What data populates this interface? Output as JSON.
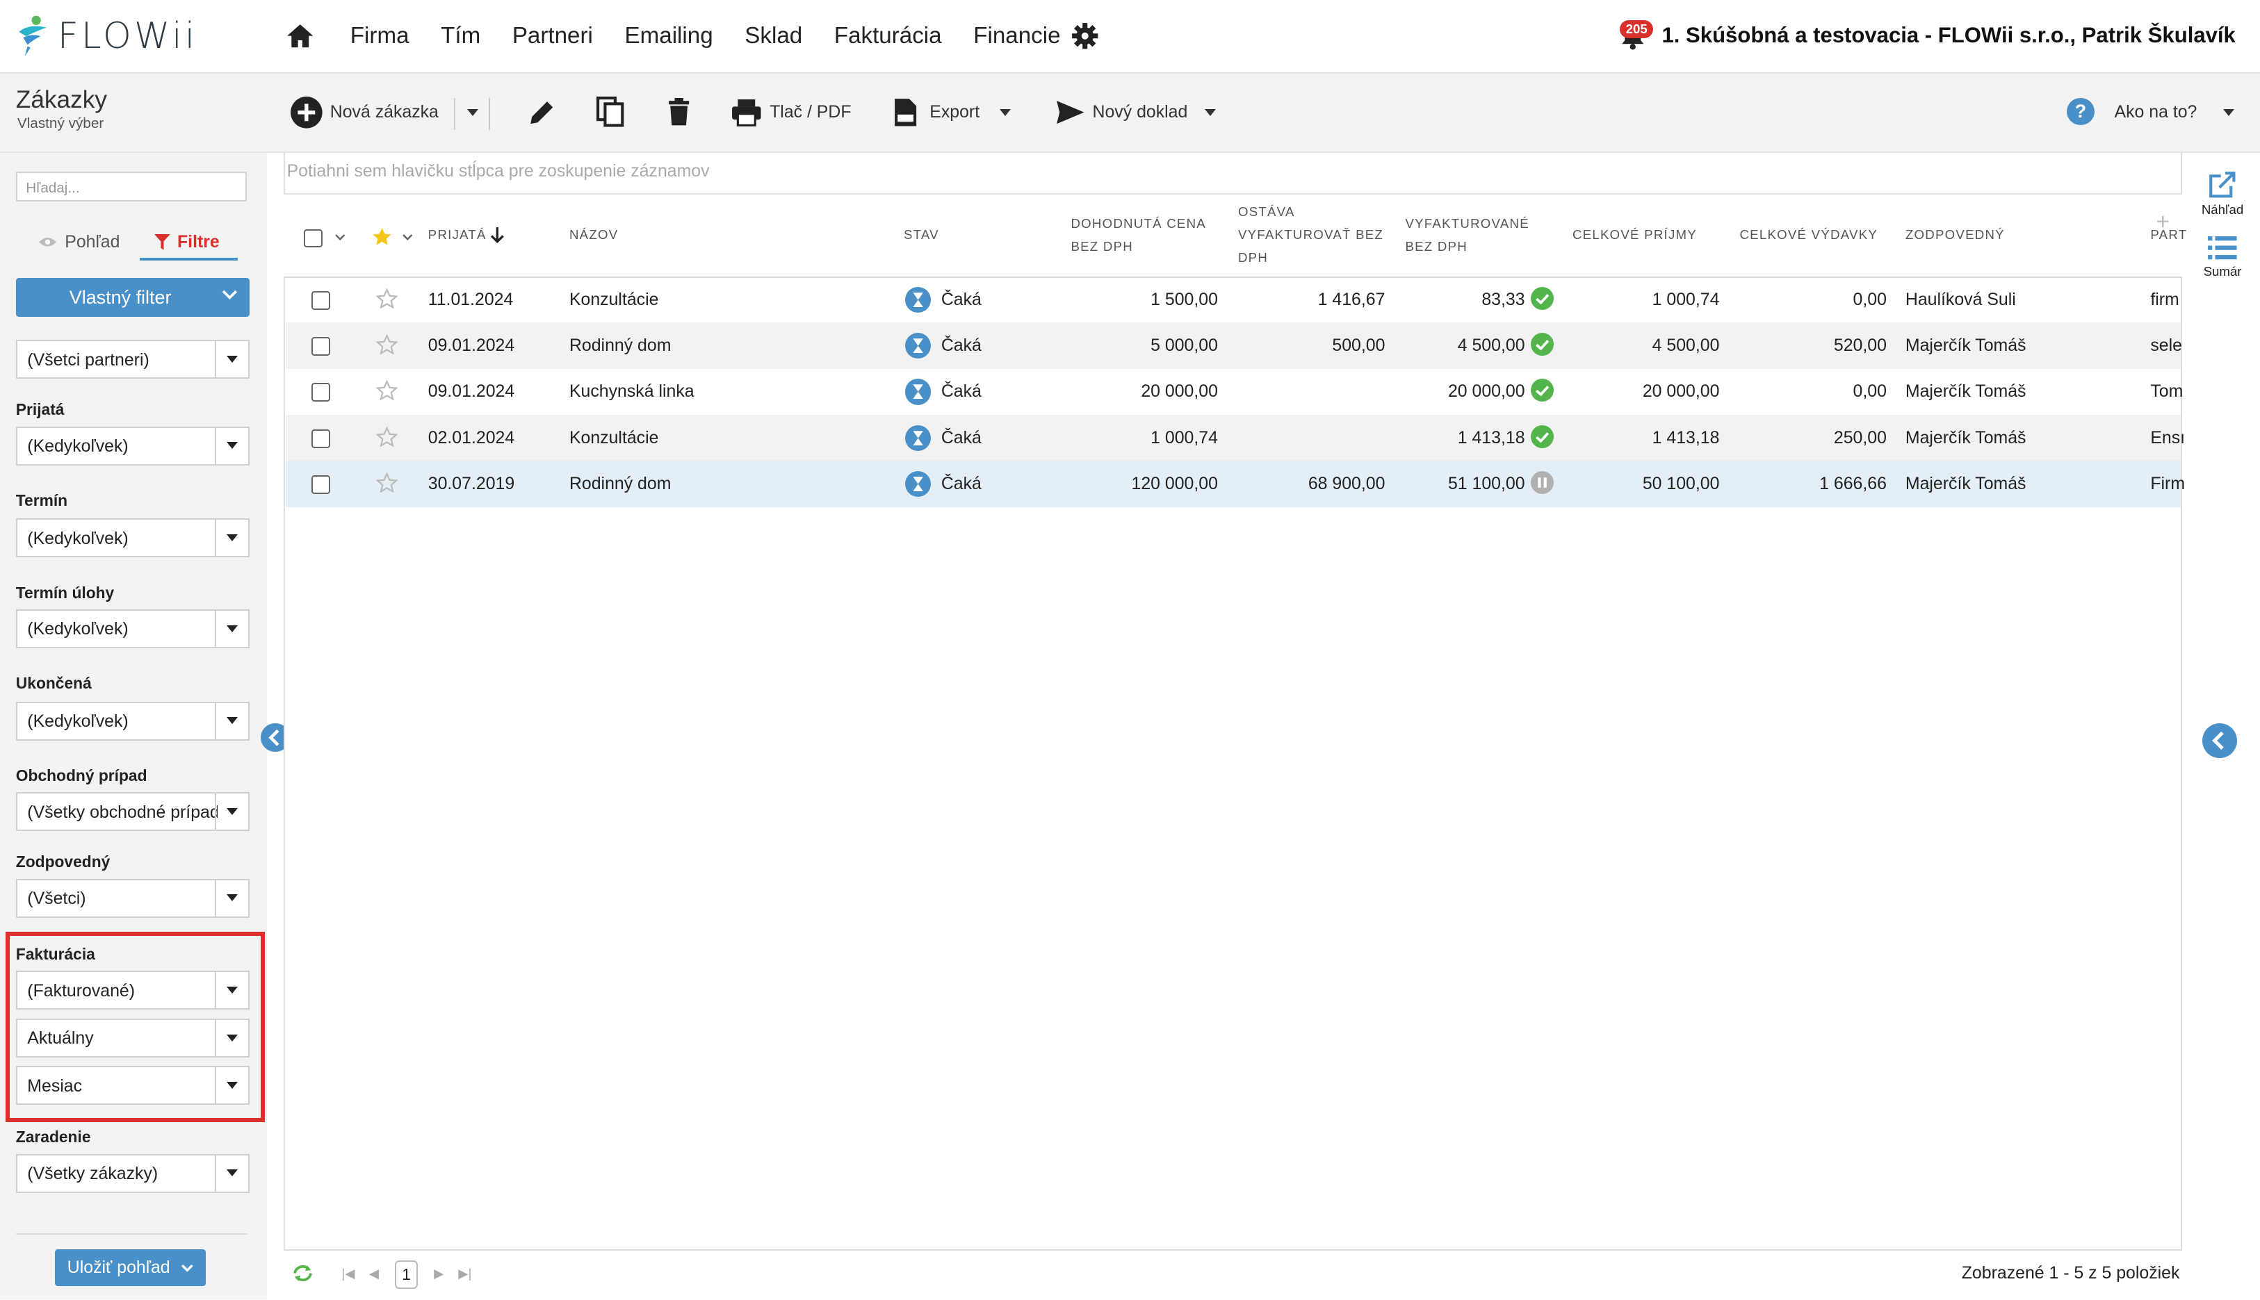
{
  "app": {
    "logo_text": "FLOWii",
    "brand_color": "#4a90c8",
    "accent_red": "#d9302c"
  },
  "nav": {
    "items": [
      "Firma",
      "Tím",
      "Partneri",
      "Emailing",
      "Sklad",
      "Fakturácia",
      "Financie"
    ],
    "notification_count": "205",
    "company_user": "1. Skúšobná a testovacia - FLOWii s.r.o., Patrik Škulavík"
  },
  "page": {
    "title": "Zákazky",
    "subtitle": "Vlastný výber"
  },
  "toolbar": {
    "new_order": "Nová zákazka",
    "print": "Tlač / PDF",
    "export": "Export",
    "new_document": "Nový doklad",
    "help": "Ako na to?"
  },
  "sidebar": {
    "search_placeholder": "Hľadaj...",
    "tab_view": "Pohľad",
    "tab_filters": "Filtre",
    "custom_filter": "Vlastný filter",
    "partners": "(Všetci partneri)",
    "filters": [
      {
        "label": "Prijatá",
        "value": "(Kedykoľvek)"
      },
      {
        "label": "Termín",
        "value": "(Kedykoľvek)"
      },
      {
        "label": "Termín úlohy",
        "value": "(Kedykoľvek)"
      },
      {
        "label": "Ukončená",
        "value": "(Kedykoľvek)"
      },
      {
        "label": "Obchodný prípad",
        "value": "(Všetky obchodné prípady)"
      },
      {
        "label": "Zodpovedný",
        "value": "(Všetci)"
      }
    ],
    "invoicing": {
      "label": "Fakturácia",
      "values": [
        "(Fakturované)",
        "Aktuálny",
        "Mesiac"
      ]
    },
    "assignment": {
      "label": "Zaradenie",
      "value": "(Všetky zákazky)"
    },
    "save_view": "Uložiť pohľad"
  },
  "grid": {
    "group_hint": "Potiahni sem hlavičku stĺpca pre zoskupenie záznamov",
    "columns": {
      "received": "Prijatá",
      "name": "Názov",
      "status": "Stav",
      "agreed_1": "Dohodnutá cena",
      "agreed_2": "bez DPH",
      "remain_1": "Ostáva",
      "remain_2": "vyfakturovať bez",
      "remain_3": "DPH",
      "invoiced_1": "Vyfakturované",
      "invoiced_2": "bez DPH",
      "income": "Celkové príjmy",
      "expenses": "Celkové výdavky",
      "responsible": "Zodpovedný",
      "partner": "Part"
    },
    "rows": [
      {
        "date": "11.01.2024",
        "name": "Konzultácie",
        "status": "Čaká",
        "agreed": "1 500,00",
        "remaining": "1 416,67",
        "invoiced": "83,33",
        "invoiced_state": "ok",
        "income": "1 000,74",
        "expenses": "0,00",
        "responsible": "Haulíková Suli",
        "partner": "firm"
      },
      {
        "date": "09.01.2024",
        "name": "Rodinný dom",
        "status": "Čaká",
        "agreed": "5 000,00",
        "remaining": "500,00",
        "invoiced": "4 500,00",
        "invoiced_state": "ok",
        "income": "4 500,00",
        "expenses": "520,00",
        "responsible": "Majerčík Tomáš",
        "partner": "sele"
      },
      {
        "date": "09.01.2024",
        "name": "Kuchynská linka",
        "status": "Čaká",
        "agreed": "20 000,00",
        "remaining": "",
        "invoiced": "20 000,00",
        "invoiced_state": "ok",
        "income": "20 000,00",
        "expenses": "0,00",
        "responsible": "Majerčík Tomáš",
        "partner": "Tom"
      },
      {
        "date": "02.01.2024",
        "name": "Konzultácie",
        "status": "Čaká",
        "agreed": "1 000,74",
        "remaining": "",
        "invoiced": "1 413,18",
        "invoiced_state": "ok",
        "income": "1 413,18",
        "expenses": "250,00",
        "responsible": "Majerčík Tomáš",
        "partner": "Ensı"
      },
      {
        "date": "30.07.2019",
        "name": "Rodinný dom",
        "status": "Čaká",
        "agreed": "120 000,00",
        "remaining": "68 900,00",
        "invoiced": "51 100,00",
        "invoiced_state": "paused",
        "income": "50 100,00",
        "expenses": "1 666,66",
        "responsible": "Majerčík Tomáš",
        "partner": "Firm"
      }
    ],
    "page_number": "1",
    "status_text": "Zobrazené 1 - 5 z 5 položiek"
  },
  "right_rail": {
    "preview": "Náhľad",
    "summary": "Sumár"
  }
}
